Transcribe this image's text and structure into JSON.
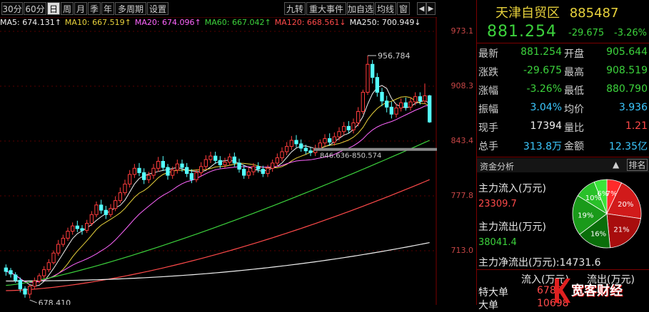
{
  "toolbar": {
    "left": [
      "30分",
      "60分",
      "日",
      "周",
      "月",
      "季",
      "年",
      "多周期",
      "设置"
    ],
    "active_index": 2,
    "right": [
      "九转",
      "重大事件",
      "加自选",
      "均线",
      "窗"
    ],
    "nav": [
      "◀",
      "▶"
    ]
  },
  "ma_legend": [
    {
      "text": "MA5: 674.131↑",
      "color": "#f0f0f0"
    },
    {
      "text": "MA10: 667.519↑",
      "color": "#e8d23c"
    },
    {
      "text": "MA20: 674.096↑",
      "color": "#ff66ff"
    },
    {
      "text": "MA60: 667.042↑",
      "color": "#3cd23c"
    },
    {
      "text": "MA120: 668.561↓",
      "color": "#ff4a4a"
    },
    {
      "text": "MA250: 700.949↓",
      "color": "#f0f0f0"
    }
  ],
  "axis_labels": [
    "973.1",
    "908.3",
    "843.4",
    "777.8",
    "713.0"
  ],
  "annotations": {
    "high": "956.784",
    "low": "678.410",
    "range": "846.636-850.574"
  },
  "quote": {
    "name": "天津自贸区",
    "code": "885487",
    "price": "881.254",
    "change": "-29.675",
    "change_pct": "-3.26%",
    "rows": [
      {
        "k1": "最新",
        "v1": "881.254",
        "c1": "green",
        "k2": "开盘",
        "v2": "905.644",
        "c2": "green"
      },
      {
        "k1": "涨跌",
        "v1": "-29.675",
        "c1": "green",
        "k2": "最高",
        "v2": "908.519",
        "c2": "green"
      },
      {
        "k1": "涨幅",
        "v1": "-3.26%",
        "c1": "green",
        "k2": "最低",
        "v2": "880.790",
        "c2": "green"
      },
      {
        "k1": "振幅",
        "v1": "3.04%",
        "c1": "cyan",
        "k2": "均价",
        "v2": "3.936",
        "c2": "cyan"
      },
      {
        "k1": "现手",
        "v1": "17394",
        "c1": "white",
        "k2": "量比",
        "v2": "1.21",
        "c2": "red"
      },
      {
        "k1": "总手",
        "v1": "313.8万",
        "c1": "cyan",
        "k2": "金额",
        "v2": "12.35亿",
        "c2": "cyan"
      }
    ]
  },
  "fund": {
    "title": "资金分析",
    "up_arrow": "▲",
    "rank_label": "排名",
    "inflow_label": "主力流入(万元)",
    "inflow_value": "23309.7",
    "outflow_label": "主力流出(万元)",
    "outflow_value": "38041.4",
    "net_label": "主力净流出(万元):",
    "net_value": "14731.6",
    "pie": [
      {
        "pct": "7%",
        "value": 7,
        "color": "#ff2a2a"
      },
      {
        "pct": "20%",
        "value": 20,
        "color": "#d11a1a"
      },
      {
        "pct": "21%",
        "value": 21,
        "color": "#a80d0d"
      },
      {
        "pct": "16%",
        "value": 16,
        "color": "#0a6e0a"
      },
      {
        "pct": "19%",
        "value": 19,
        "color": "#1a9a1a"
      },
      {
        "pct": "10%",
        "value": 10,
        "color": "#29c029"
      },
      {
        "pct": "6%",
        "value": 6,
        "color": "#39e339"
      }
    ],
    "table_headers": [
      "流入(万元)",
      "流出(万元)"
    ],
    "table_rows": [
      {
        "label": "特大单",
        "inflow": "6780"
      },
      {
        "label": "大单",
        "inflow": "10698"
      }
    ]
  },
  "logo": {
    "text": "宽客财经"
  },
  "chart_data": {
    "type": "candlestick",
    "ylim": [
      688,
      988
    ],
    "candles": [
      [
        714,
        710,
        718,
        705
      ],
      [
        711,
        707,
        714,
        703
      ],
      [
        706,
        700,
        709,
        697
      ],
      [
        700,
        690,
        703,
        686
      ],
      [
        690,
        684,
        693,
        680
      ],
      [
        684,
        693,
        695,
        679
      ],
      [
        693,
        699,
        703,
        690
      ],
      [
        699,
        705,
        708,
        696
      ],
      [
        705,
        712,
        716,
        702
      ],
      [
        712,
        720,
        724,
        709
      ],
      [
        720,
        731,
        734,
        718
      ],
      [
        731,
        741,
        746,
        728
      ],
      [
        741,
        748,
        752,
        738
      ],
      [
        748,
        756,
        760,
        745
      ],
      [
        756,
        762,
        766,
        752
      ],
      [
        762,
        759,
        768,
        755
      ],
      [
        759,
        757,
        763,
        752
      ],
      [
        757,
        765,
        769,
        754
      ],
      [
        765,
        775,
        779,
        762
      ],
      [
        775,
        786,
        790,
        772
      ],
      [
        786,
        780,
        792,
        776
      ],
      [
        780,
        775,
        785,
        770
      ],
      [
        775,
        782,
        787,
        772
      ],
      [
        782,
        791,
        796,
        779
      ],
      [
        791,
        800,
        806,
        788
      ],
      [
        800,
        810,
        815,
        797
      ],
      [
        810,
        821,
        826,
        806
      ],
      [
        821,
        828,
        833,
        817
      ],
      [
        828,
        823,
        834,
        819
      ],
      [
        823,
        815,
        828,
        810
      ],
      [
        815,
        820,
        824,
        811
      ],
      [
        820,
        828,
        833,
        816
      ],
      [
        828,
        836,
        841,
        824
      ],
      [
        836,
        829,
        842,
        825
      ],
      [
        829,
        820,
        833,
        815
      ],
      [
        820,
        826,
        830,
        816
      ],
      [
        826,
        833,
        838,
        822
      ],
      [
        833,
        829,
        838,
        824
      ],
      [
        829,
        822,
        834,
        818
      ],
      [
        822,
        815,
        827,
        811
      ],
      [
        815,
        823,
        827,
        812
      ],
      [
        823,
        830,
        835,
        819
      ],
      [
        830,
        838,
        843,
        826
      ],
      [
        838,
        842,
        847,
        834
      ],
      [
        842,
        837,
        847,
        833
      ],
      [
        837,
        832,
        842,
        828
      ],
      [
        832,
        835,
        840,
        828
      ],
      [
        835,
        841,
        845,
        831
      ],
      [
        841,
        834,
        846,
        830
      ],
      [
        834,
        827,
        839,
        823
      ],
      [
        827,
        820,
        832,
        816
      ],
      [
        820,
        824,
        829,
        816
      ],
      [
        824,
        830,
        834,
        820
      ],
      [
        830,
        827,
        835,
        823
      ],
      [
        827,
        822,
        831,
        818
      ],
      [
        822,
        828,
        832,
        818
      ],
      [
        828,
        834,
        838,
        824
      ],
      [
        834,
        840,
        845,
        830
      ],
      [
        840,
        847,
        852,
        836
      ],
      [
        847,
        853,
        858,
        843
      ],
      [
        853,
        860,
        865,
        849
      ],
      [
        860,
        856,
        866,
        852
      ],
      [
        856,
        851,
        861,
        847
      ],
      [
        851,
        848,
        855,
        844
      ],
      [
        848,
        846,
        852,
        842
      ],
      [
        846,
        851,
        855,
        842
      ],
      [
        851,
        857,
        861,
        848
      ],
      [
        857,
        862,
        867,
        853
      ],
      [
        862,
        858,
        868,
        854
      ],
      [
        858,
        864,
        869,
        854
      ],
      [
        864,
        870,
        875,
        860
      ],
      [
        870,
        876,
        881,
        866
      ],
      [
        876,
        872,
        882,
        868
      ],
      [
        872,
        880,
        885,
        868
      ],
      [
        880,
        893,
        898,
        876
      ],
      [
        893,
        915,
        918,
        890
      ],
      [
        915,
        947,
        957,
        912
      ],
      [
        947,
        932,
        952,
        925
      ],
      [
        932,
        915,
        937,
        910
      ],
      [
        915,
        905,
        920,
        899
      ],
      [
        905,
        898,
        911,
        892
      ],
      [
        898,
        890,
        904,
        885
      ],
      [
        890,
        897,
        902,
        886
      ],
      [
        897,
        903,
        908,
        893
      ],
      [
        903,
        898,
        909,
        894
      ],
      [
        898,
        904,
        909,
        894
      ],
      [
        904,
        910,
        915,
        900
      ],
      [
        910,
        905,
        915,
        901
      ],
      [
        905,
        911,
        925,
        902
      ],
      [
        911,
        881,
        912,
        880
      ]
    ]
  }
}
